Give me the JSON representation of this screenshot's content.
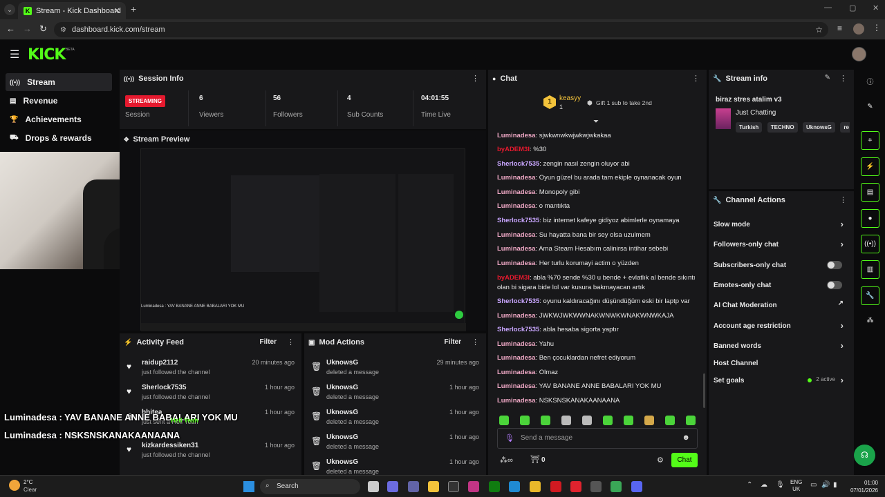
{
  "browser": {
    "tab_title": "Stream - Kick Dashboard",
    "url": "dashboard.kick.com/stream"
  },
  "app": {
    "logo": "KICK",
    "beta": "BETA"
  },
  "sidebar": {
    "items": [
      {
        "label": "Stream",
        "icon": "stream-icon"
      },
      {
        "label": "Revenue",
        "icon": "revenue-icon"
      },
      {
        "label": "Achievements",
        "icon": "trophy-icon"
      },
      {
        "label": "Drops & rewards",
        "icon": "drops-icon"
      }
    ]
  },
  "session": {
    "title": "Session Info",
    "status": "STREAMING",
    "status_label": "Session",
    "stats": [
      {
        "value": "6",
        "label": "Viewers"
      },
      {
        "value": "56",
        "label": "Followers"
      },
      {
        "value": "4",
        "label": "Sub Counts"
      },
      {
        "value": "04:01:55",
        "label": "Time Live"
      }
    ]
  },
  "preview": {
    "title": "Stream Preview",
    "caption": "Luminadesa : YAV BANANE ANNE BABALARI YOK MU"
  },
  "activity": {
    "title": "Activity Feed",
    "filter": "Filter",
    "rows": [
      {
        "user": "raidup2112",
        "action": "just followed the channel",
        "time": "20 minutes ago"
      },
      {
        "user": "Sherlock7535",
        "action": "just followed the channel",
        "time": "1 hour ago"
      },
      {
        "user": "bhitea",
        "action": "just sent a Hell Yeah",
        "time": "1 hour ago"
      },
      {
        "user": "kizkardessiken31",
        "action": "just followed the channel",
        "time": "1 hour ago"
      }
    ]
  },
  "mod": {
    "title": "Mod Actions",
    "filter": "Filter",
    "rows": [
      {
        "user": "UknowsG",
        "action": "deleted a message",
        "time": "29 minutes ago"
      },
      {
        "user": "UknowsG",
        "action": "deleted a message",
        "time": "1 hour ago"
      },
      {
        "user": "UknowsG",
        "action": "deleted a message",
        "time": "1 hour ago"
      },
      {
        "user": "UknowsG",
        "action": "deleted a message",
        "time": "1 hour ago"
      },
      {
        "user": "UknowsG",
        "action": "deleted a message",
        "time": "1 hour ago"
      }
    ]
  },
  "chat": {
    "title": "Chat",
    "top_user": "keasyy",
    "top_rank": "1",
    "top_count": "1",
    "gift_prompt": "Gift 1 sub to take 2nd",
    "messages": [
      {
        "user": "Luminadesa",
        "color": "#f0a9c6",
        "text": "sjwkwnwkwjwkwjwkakaa"
      },
      {
        "user": "byADEM3I",
        "color": "#e5192e",
        "text": "%30"
      },
      {
        "user": "Sherlock7535",
        "color": "#c9a6ff",
        "text": "zengin nasıl zengin oluyor abi"
      },
      {
        "user": "Luminadesa",
        "color": "#f0a9c6",
        "text": "Oyun güzel bu arada tam ekiple oynanacak oyun"
      },
      {
        "user": "Luminadesa",
        "color": "#f0a9c6",
        "text": "Monopoly gibi"
      },
      {
        "user": "Luminadesa",
        "color": "#f0a9c6",
        "text": "o mantıkta"
      },
      {
        "user": "Sherlock7535",
        "color": "#c9a6ff",
        "text": "biz internet kafeye gidiyoz abimlerle oynamaya"
      },
      {
        "user": "Luminadesa",
        "color": "#f0a9c6",
        "text": "Su hayatta bana bir sey olsa uzulmem"
      },
      {
        "user": "Luminadesa",
        "color": "#f0a9c6",
        "text": "Ama Steam Hesabım calinirsa intihar sebebi"
      },
      {
        "user": "Luminadesa",
        "color": "#f0a9c6",
        "text": "Her turlu korumayi actim o yüzden"
      },
      {
        "user": "byADEM3I",
        "color": "#e5192e",
        "text": "abla %70 sende %30 u bende + evlatlık al bende sıkıntı olan bi sigara bide lol var kusura bakmayacan artık"
      },
      {
        "user": "Sherlock7535",
        "color": "#c9a6ff",
        "text": "oyunu kaldıracağını düşündüğüm eski bir laptp var"
      },
      {
        "user": "Luminadesa",
        "color": "#f0a9c6",
        "text": "JWKWJWKWWNAKWNWKWNAKWNWKAJA"
      },
      {
        "user": "Sherlock7535",
        "color": "#c9a6ff",
        "text": "abla hesaba sigorta yaptır"
      },
      {
        "user": "Luminadesa",
        "color": "#f0a9c6",
        "text": "Yahu"
      },
      {
        "user": "Luminadesa",
        "color": "#f0a9c6",
        "text": "Ben çocuklardan nefret ediyorum"
      },
      {
        "user": "Luminadesa",
        "color": "#f0a9c6",
        "text": "Olmaz"
      },
      {
        "user": "Luminadesa",
        "color": "#f0a9c6",
        "text": "YAV BANANE ANNE BABALARI YOK MU"
      },
      {
        "user": "Luminadesa",
        "color": "#f0a9c6",
        "text": "NSKSNSKANAKAANAANA"
      }
    ],
    "input_placeholder": "Send a message",
    "points": "0",
    "send_label": "Chat"
  },
  "stream_info": {
    "title": "Stream info",
    "stream_title": "biraz stres atalim v3",
    "category": "Just Chatting",
    "tags": [
      "Turkish",
      "TECHNO",
      "UknowsG",
      "re"
    ]
  },
  "channel_actions": {
    "title": "Channel Actions",
    "items": [
      {
        "label": "Slow mode",
        "control": "chevron"
      },
      {
        "label": "Followers-only chat",
        "control": "chevron"
      },
      {
        "label": "Subscribers-only chat",
        "control": "toggle"
      },
      {
        "label": "Emotes-only chat",
        "control": "toggle"
      },
      {
        "label": "AI Chat Moderation",
        "control": "external"
      },
      {
        "label": "Account age restriction",
        "control": "chevron"
      },
      {
        "label": "Banned words",
        "control": "chevron"
      },
      {
        "label": "Host Channel",
        "control": "none"
      },
      {
        "label": "Set goals",
        "control": "chevron"
      }
    ],
    "goals_status": "2 active"
  },
  "overlay": {
    "line1": "Luminadesa : YAV BANANE ANNE BABALARI YOK MU",
    "line2": "Luminadesa : NSKSNSKANAKAANAANA",
    "hell_yeah": "Hell Yeah"
  },
  "taskbar": {
    "weather_temp": "2°C",
    "weather_desc": "Clear",
    "search_placeholder": "Search",
    "lang": "ENG",
    "region": "UK",
    "time": "01:00",
    "date": "07/01/2026"
  },
  "colors": {
    "accent": "#53fc18",
    "live_red": "#e5192e",
    "panel": "#18181a"
  }
}
